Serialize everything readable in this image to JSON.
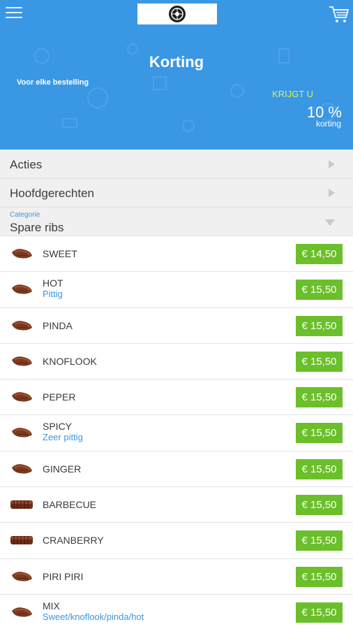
{
  "header": {
    "title": "Korting",
    "subtitle": "Voor elke bestelling",
    "offer_label": "KRIJGT U",
    "discount_value": "10 %",
    "discount_label": "korting"
  },
  "categories": [
    {
      "label": "Acties"
    },
    {
      "label": "Hoofdgerechten"
    }
  ],
  "selected_category": {
    "small_label": "Categorie",
    "label": "Spare ribs"
  },
  "items": [
    {
      "name": "SWEET",
      "desc": "",
      "price": "€ 14,50",
      "img": "rib"
    },
    {
      "name": "HOT",
      "desc": "Pittig",
      "price": "€ 15,50",
      "img": "rib"
    },
    {
      "name": "PINDA",
      "desc": "",
      "price": "€ 15,50",
      "img": "rib"
    },
    {
      "name": "KNOFLOOK",
      "desc": "",
      "price": "€ 15,50",
      "img": "rib"
    },
    {
      "name": "PEPER",
      "desc": "",
      "price": "€ 15,50",
      "img": "rib"
    },
    {
      "name": "SPICY",
      "desc": "Zeer pittig",
      "price": "€ 15,50",
      "img": "rib"
    },
    {
      "name": "GINGER",
      "desc": "",
      "price": "€ 15,50",
      "img": "rib"
    },
    {
      "name": "BARBECUE",
      "desc": "",
      "price": "€ 15,50",
      "img": "rack"
    },
    {
      "name": "CRANBERRY",
      "desc": "",
      "price": "€ 15,50",
      "img": "rack"
    },
    {
      "name": "PIRI PIRI",
      "desc": "",
      "price": "€ 15,50",
      "img": "rib"
    },
    {
      "name": "MIX",
      "desc": "Sweet/knoflook/pinda/hot",
      "price": "€ 15,50",
      "img": "rib"
    }
  ],
  "colors": {
    "header_bg": "#3a97e4",
    "accent_yellow": "#d8f05a",
    "price_green": "#6bbf2a",
    "link_blue": "#3a97e4"
  },
  "icons": {
    "menu": "menu-icon",
    "cart": "cart-icon",
    "logo": "logo-icon",
    "chevron_right": "chevron-right-icon",
    "chevron_down": "chevron-down-icon"
  }
}
